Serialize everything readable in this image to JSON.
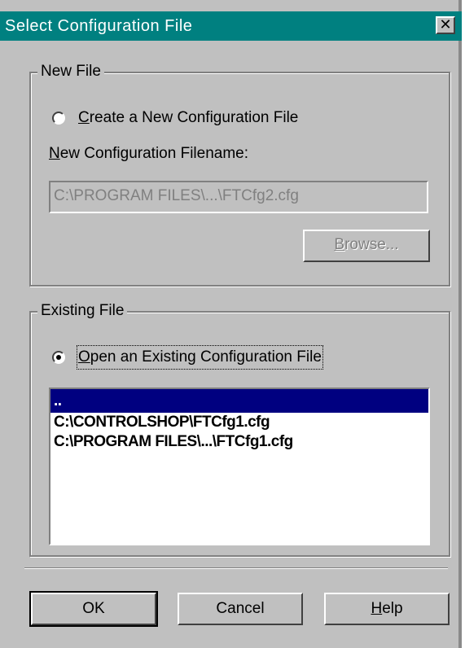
{
  "dialog": {
    "title": "Select Configuration File",
    "close_glyph": "✕"
  },
  "new_file": {
    "group_label": "New File",
    "radio_mnemonic": "C",
    "radio_label_rest": "reate a New Configuration File",
    "filename_label_mnemonic": "N",
    "filename_label_rest": "ew Configuration Filename:",
    "filename_value": "C:\\PROGRAM FILES\\...\\FTCfg2.cfg",
    "browse_mnemonic": "B",
    "browse_rest": "rowse..."
  },
  "existing_file": {
    "group_label": "Existing File",
    "radio_mnemonic": "O",
    "radio_label_rest": "pen an Existing Configuration File",
    "files": [
      "..",
      "C:\\CONTROLSHOP\\FTCfg1.cfg",
      "C:\\PROGRAM FILES\\...\\FTCfg1.cfg"
    ]
  },
  "buttons": {
    "ok_label": "OK",
    "cancel_label": "Cancel",
    "help_mnemonic": "H",
    "help_rest": "elp"
  },
  "colors": {
    "titlebar": "#008080",
    "dialog_face": "#c0c0c0",
    "selection": "#000080"
  }
}
